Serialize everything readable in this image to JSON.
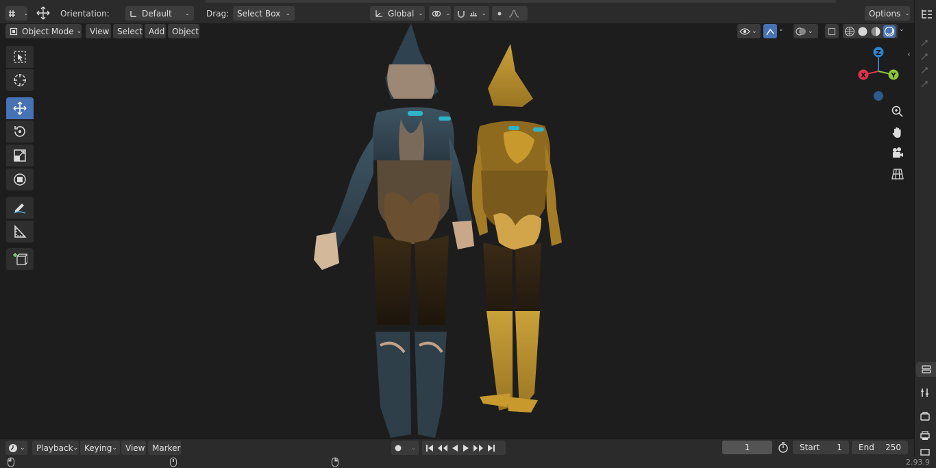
{
  "header": {
    "orientation_label": "Orientation:",
    "orientation_value": "Default",
    "drag_label": "Drag:",
    "drag_value": "Select Box",
    "transform_space": "Global",
    "options_label": "Options"
  },
  "viewport_header": {
    "mode": "Object Mode",
    "menus": [
      "View",
      "Select",
      "Add",
      "Object"
    ]
  },
  "toolbar": {
    "tools": [
      "select-box",
      "cursor",
      "move",
      "rotate",
      "scale",
      "transform",
      "annotate",
      "measure",
      "add-cube"
    ],
    "active_tool": "move"
  },
  "gizmo": {
    "z": "Z",
    "x": "X",
    "y": "Y"
  },
  "timeline": {
    "menus": [
      "Playback",
      "Keying",
      "View",
      "Marker"
    ],
    "current_frame": "1",
    "start_label": "Start",
    "start_value": "1",
    "end_label": "End",
    "end_value": "250"
  },
  "status": {
    "version": "2.93.9"
  },
  "colors": {
    "accent": "#4772b3",
    "axis_x": "#e0364a",
    "axis_y": "#8cc63e",
    "axis_z": "#2d82c8"
  }
}
